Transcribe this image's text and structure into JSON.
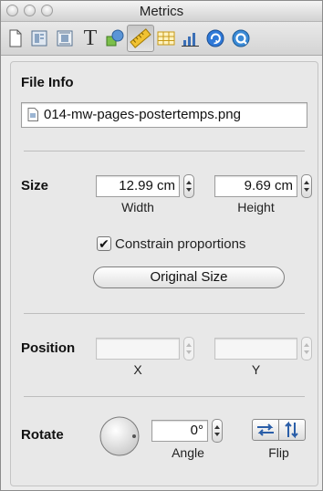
{
  "window": {
    "title": "Metrics"
  },
  "toolbar": {
    "items": [
      {
        "icon": "document-icon"
      },
      {
        "icon": "layout-icon"
      },
      {
        "icon": "wrap-icon"
      },
      {
        "icon": "text-icon",
        "glyph": "T"
      },
      {
        "icon": "graphic-icon"
      },
      {
        "icon": "metrics-ruler-icon",
        "active": true
      },
      {
        "icon": "table-icon"
      },
      {
        "icon": "chart-icon"
      },
      {
        "icon": "link-icon"
      },
      {
        "icon": "quicktime-icon"
      }
    ]
  },
  "file_info": {
    "label": "File Info",
    "filename": "014-mw-pages-postertemps.png"
  },
  "size": {
    "label": "Size",
    "width_value": "12.99 cm",
    "height_value": "9.69 cm",
    "width_label": "Width",
    "height_label": "Height",
    "constrain_label": "Constrain proportions",
    "constrain_checked": "✔",
    "original_size_button": "Original Size"
  },
  "position": {
    "label": "Position",
    "x_value": "",
    "y_value": "",
    "x_label": "X",
    "y_label": "Y"
  },
  "rotate": {
    "label": "Rotate",
    "angle_value": "0°",
    "angle_label": "Angle",
    "flip_label": "Flip"
  }
}
